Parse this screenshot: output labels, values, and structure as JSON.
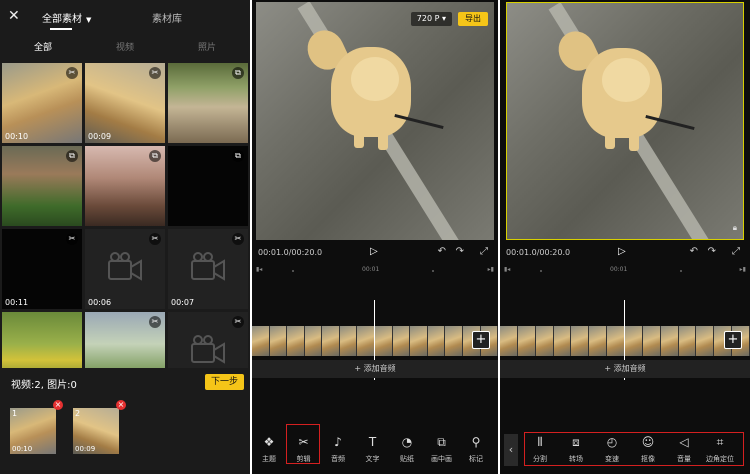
{
  "panel1": {
    "close_icon": "close-icon",
    "tabs": {
      "all_material": "全部素材",
      "library": "素材库"
    },
    "filters": [
      "全部",
      "视频",
      "照片"
    ],
    "grid": [
      {
        "thumb": "dog",
        "badge": "✂",
        "duration": "00:10"
      },
      {
        "thumb": "dog2",
        "badge": "✂",
        "duration": "00:09"
      },
      {
        "thumb": "guitar1",
        "badge": "⧉",
        "duration": ""
      },
      {
        "thumb": "guitar2",
        "badge": "⧉",
        "duration": ""
      },
      {
        "thumb": "girl",
        "badge": "⧉",
        "duration": ""
      },
      {
        "thumb": "dark",
        "badge": "⧉",
        "duration": ""
      },
      {
        "thumb": "dark",
        "badge": "✂",
        "duration": "00:11"
      },
      {
        "thumb": "placeholder",
        "badge": "✂",
        "duration": "00:06"
      },
      {
        "thumb": "placeholder",
        "badge": "✂",
        "duration": "00:07"
      },
      {
        "thumb": "flowers",
        "badge": "",
        "duration": ""
      },
      {
        "thumb": "trees",
        "badge": "✂",
        "duration": ""
      },
      {
        "thumb": "placeholder",
        "badge": "✂",
        "duration": ""
      }
    ],
    "selection_summary": "视频:2, 图片:0",
    "next_button": "下一步",
    "selected": [
      {
        "num": "1",
        "duration": "00:10"
      },
      {
        "num": "2",
        "duration": "00:09"
      }
    ]
  },
  "editor": {
    "resolution": "720 P",
    "export_label": "导出",
    "timecode": "00:01.0/00:20.0",
    "ruler_mark": "00:01",
    "add_audio": "+ 添加音频"
  },
  "panel2_tools": [
    {
      "icon": "theme-icon",
      "glyph": "❖",
      "label": "主题"
    },
    {
      "icon": "scissors-icon",
      "glyph": "✂",
      "label": "剪辑"
    },
    {
      "icon": "music-icon",
      "glyph": "♪",
      "label": "音频"
    },
    {
      "icon": "text-icon",
      "glyph": "T",
      "label": "文字"
    },
    {
      "icon": "sticker-icon",
      "glyph": "◔",
      "label": "贴纸"
    },
    {
      "icon": "pip-icon",
      "glyph": "⧉",
      "label": "画中画"
    },
    {
      "icon": "marker-icon",
      "glyph": "⚲",
      "label": "标记"
    }
  ],
  "panel3_tools": [
    {
      "icon": "split-icon",
      "glyph": "⫴",
      "label": "分割"
    },
    {
      "icon": "transition-icon",
      "glyph": "⧈",
      "label": "转场"
    },
    {
      "icon": "speed-icon",
      "glyph": "◴",
      "label": "变速"
    },
    {
      "icon": "portrait-icon",
      "glyph": "☺",
      "label": "抠像"
    },
    {
      "icon": "volume-icon",
      "glyph": "◁",
      "label": "音量"
    },
    {
      "icon": "corner-icon",
      "glyph": "⌗",
      "label": "边角定位"
    }
  ],
  "colors": {
    "accent": "#f5c518",
    "highlight": "#d42020",
    "delete": "#e53030"
  }
}
